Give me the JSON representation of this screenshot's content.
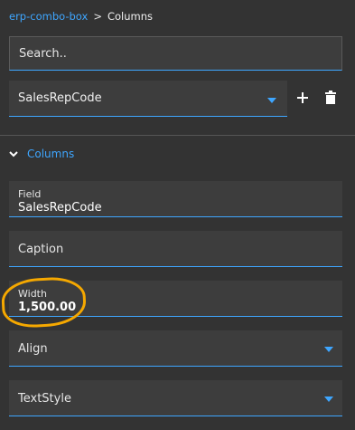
{
  "breadcrumb": {
    "parent": "erp-combo-box",
    "separator": ">",
    "current": "Columns"
  },
  "search": {
    "placeholder": "Search.."
  },
  "column_select": {
    "value": "SalesRepCode",
    "add_icon": "plus-icon",
    "delete_icon": "trash-icon"
  },
  "section": {
    "title": "Columns",
    "icon": "chevron-down-icon",
    "expanded": true
  },
  "fields": {
    "field": {
      "label": "Field",
      "value": "SalesRepCode"
    },
    "caption": {
      "placeholder": "Caption"
    },
    "width": {
      "label": "Width",
      "value": "1,500.00"
    },
    "align": {
      "placeholder": "Align"
    },
    "textstyle": {
      "placeholder": "TextStyle"
    }
  },
  "colors": {
    "accent": "#3ea6ff",
    "background": "#333333",
    "input_background": "#3d3d3d",
    "highlight_annotation": "#f5a800"
  }
}
